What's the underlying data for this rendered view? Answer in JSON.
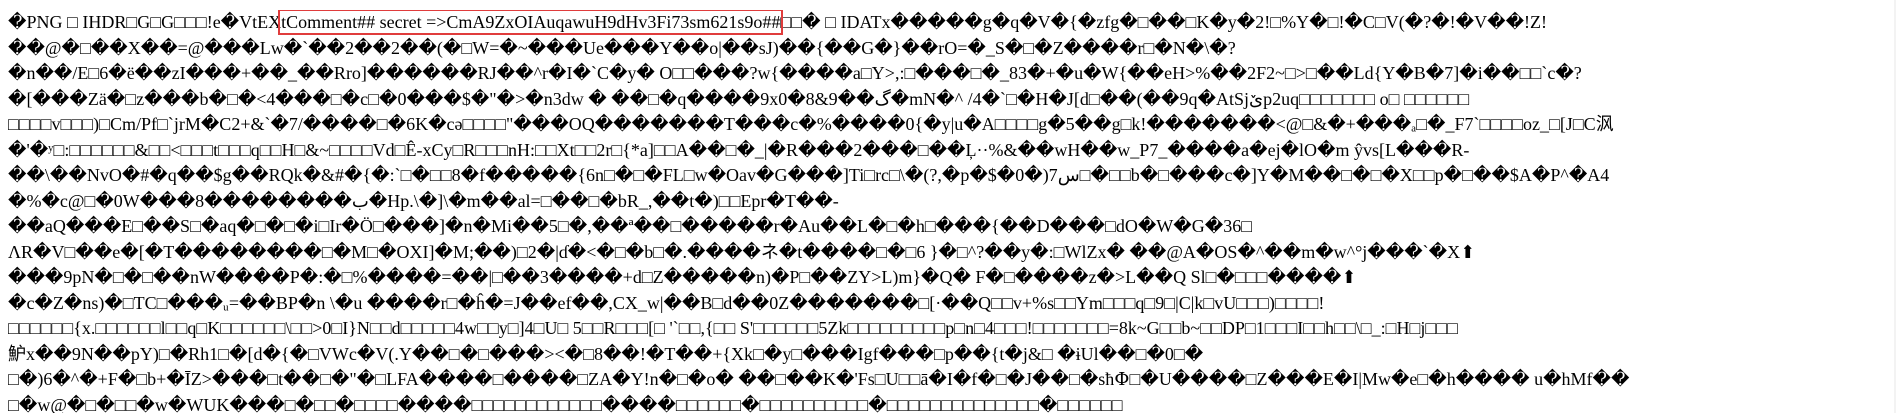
{
  "highlight_color": "#e03c3c",
  "lines": [
    {
      "pre": "�PNG □ IHDR□G□G□□□!e�VtEX",
      "highlight": "tComment## secret =>CmA9ZxOIAuqawuH9dHv3Fi73sm621s9o##",
      "post": "□□� □ IDATx�����g�q�V�{�zfg�□��□K�y�2!□%Y�□!�C□V(�?�!�V��!Z!"
    },
    {
      "text": "��@�□��X��=@���Lw�`��2��2��(�□W=�~���Ue���Y��o|��sJ)��{��G�}��rO=�_S�□�Z����r□�N�\\�?"
    },
    {
      "text": "�n��/E□6�ë��zI���+��_��Rro]������RJ��^r�I�`C�y� O□□���?w{����a□Y>,:□���□�_83�+�u�W{��eH>%��2F2~□>□��Ld{Y�B�7]�i��□□`c�?"
    },
    {
      "text": "�[���Zä�□z���b�□�<4���□�c□�0���$�\"�>�n3dw � ��□�q����9x0�8&9��گ�mN�^ /4�`□�H�J[d□��(��9q�AtSjێp2uq□□□□□□□ o□ □□□□□□"
    },
    {
      "text": "□□□□v□□□)□Cm/Pf□`јrM�C2+&`�7/����□�6K�cə□□□□\"���OQ�������T���c�%����0{�y|u�A□□□□g�5��g□k!�������<@□&�+���ₐ□�_F7`□□□□oz_□[J□C沨"
    },
    {
      "text": "�'�ʸ□:□□□□□□&□□<□□□t□□□q□□H□&~□□□□Vd□Ê-xCy□R□□□nH:□□Xt□□2r□{*a]□□A��□�_|�R���2���□��Ļ··%&��wH��w_P7_����a�ej�lO�m ŷvs[L���R-"
    },
    {
      "text": "��\\��NvO�#�q��$g��RQk�&#�{�:`□�□□8�f�����{6n□�□�FL□w�Oav�G���]Ti□rc□\\�(?,�p�$�0�)7س□�□□b�□���c�]Y�M��□�□�X□□p�□��$A�P^�A4"
    },
    {
      "text": "�%�c@□�0W���8��������ب�Hp.\\�]\\�m��al=□��□�bR_,��t�)□□Epr�T��-"
    },
    {
      "text": "��aQ���E□��S□�aq�□�□�i□Ir�Ö□���]�n�Mi��5□�,��ª��□�����r�Au��L�□�h□���{��D���□dO�W�G�36□"
    },
    {
      "text": "ɅR�V□��e�[�T��������□�M□�OXI]�M;��)□2�|ɗ�<�□�b□�.����ネ�t����□�□6 }�□^?��y�:□WlZx� ��@A�OS�^��m�w^°j���`�X⬆"
    },
    {
      "text": "���9pN�□�□��nW����P�:�□%����=��|□��3����+d□Z�����n)�P□��ZY>L)m}�Q� F�□����z�>L��Q Sl□�□□□����⬆"
    },
    {
      "text": "�c�Z�ns)�□TC□���ᵤ=��BP�n \\�u ����r□�ĥ�=J��ef��,CX_w|��B□d��0Z�������□[·��Q□□v+%s□□Ym□□□q□9□|C|k□vU□□□)□□□□!"
    },
    {
      "text": "□□□□□□{x.□□□□□□l□□q□K□□□□□□\\□□>0□I}N□□d□□□□□4w□□y□]4□U□ 5□□R□□□[□ '`□□,{□□ S'□□□□□□5Zk□□□□□□□□□p□n□4□□□!□□□□□□□=8k~G□□b~□□DP□1□□□I□□h□□\\□_:□H□j□□□"
    },
    {
      "text": "魲x��9N��pY)□�Rh1□�[d�{�□VWc�V(.Y��□�□���><�□8��!�T��+{Xk□�y□���Igf���□p��{t�j&□ �ɨUl��□�0□�"
    },
    {
      "text": "□�)6�^�+F�□b+�ĪZ>���□t��□�\"�□LFA����□����□ZA�Y!n�□�o� ��□��K�'Fs□U□□ā�I�f�□�J��□�sħՓ□�U����□Z���E�I|Mw�e□�h���� u�hMf��"
    },
    {
      "text": "□�w@�□�□□�w�WUK���□�□□�□□□□����□□□□□□□□□□□□����□□□□□□�□□□□□□□□□□�□□□□□□□□□□□□□□�□□□□□□"
    }
  ]
}
